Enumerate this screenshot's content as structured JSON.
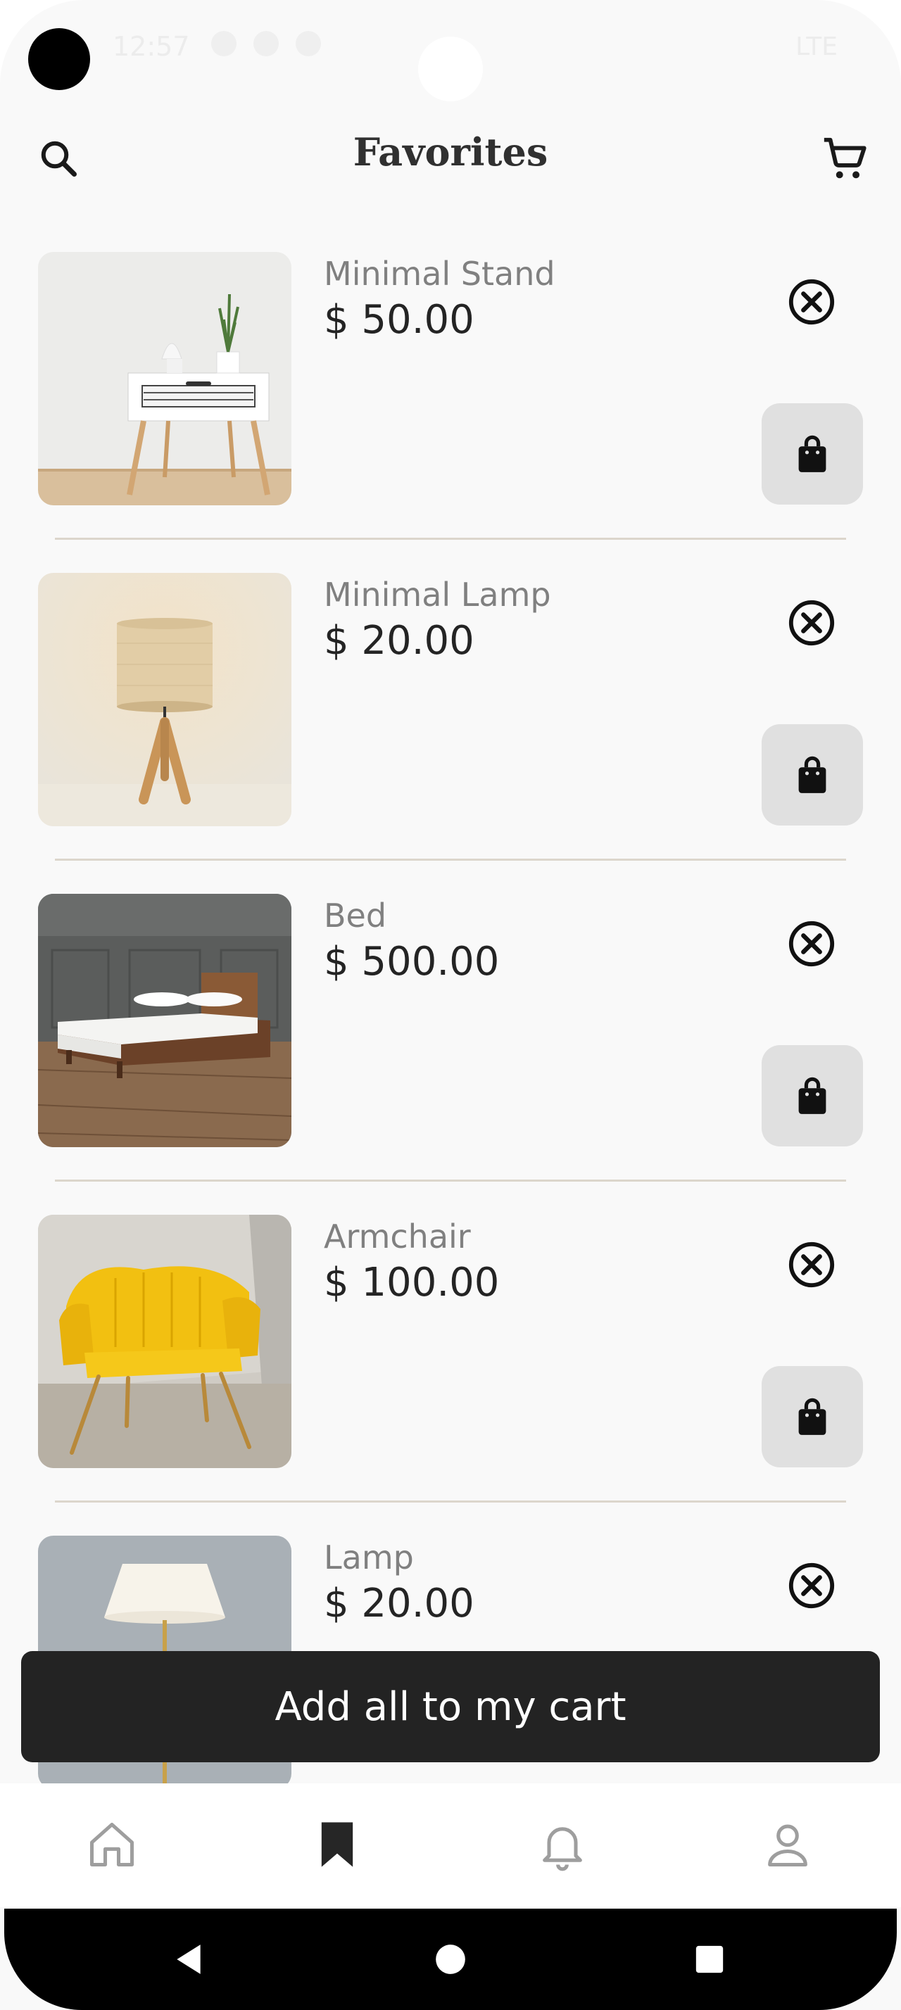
{
  "status_bar": {
    "time": "12:57",
    "network": "LTE"
  },
  "header": {
    "title": "Favorites",
    "search_icon": "search-icon",
    "cart_icon": "cart-icon"
  },
  "favorites": [
    {
      "name": "Minimal Stand",
      "price": "$ 50.00",
      "image": "nightstand"
    },
    {
      "name": "Minimal Lamp",
      "price": "$ 20.00",
      "image": "table-lamp"
    },
    {
      "name": "Bed",
      "price": "$ 500.00",
      "image": "bed"
    },
    {
      "name": "Armchair",
      "price": "$ 100.00",
      "image": "yellow-armchair"
    },
    {
      "name": "Lamp",
      "price": "$ 20.00",
      "image": "floor-lamp"
    }
  ],
  "actions": {
    "add_all_label": "Add all to my cart"
  },
  "bottom_nav": {
    "items": [
      "home-icon",
      "bookmark-icon",
      "bell-icon",
      "profile-icon"
    ],
    "active": "bookmark-icon"
  },
  "colors": {
    "background": "#f9f9f9",
    "primary_dark": "#232323",
    "bag_button": "#e0e0e0",
    "divider": "#dcd6cc",
    "muted_text": "#808080"
  }
}
